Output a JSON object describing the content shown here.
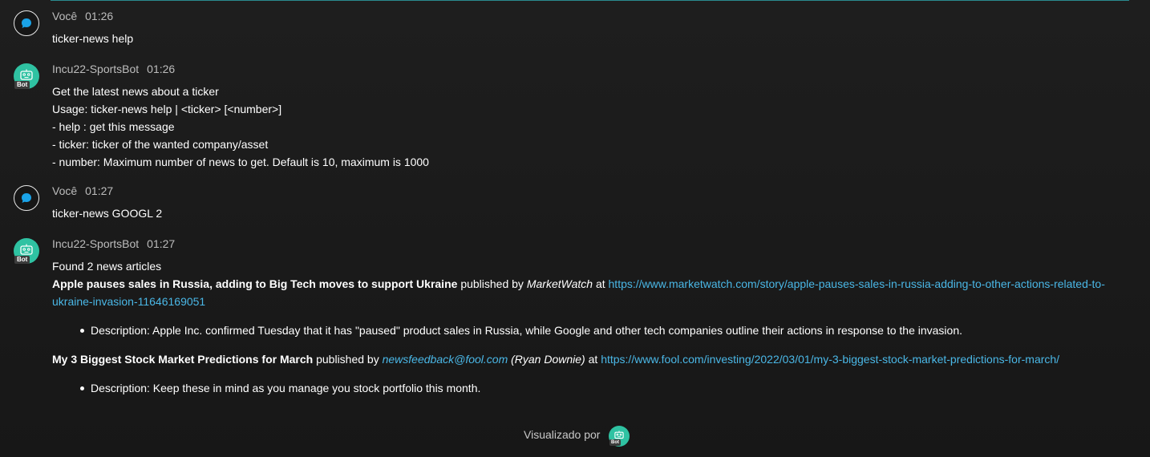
{
  "messages": [
    {
      "author": "Você",
      "time": "01:26",
      "lines": [
        "ticker-news help"
      ]
    },
    {
      "author": "Incu22-SportsBot",
      "badge": "Bot",
      "time": "01:26",
      "lines": [
        "Get the latest news about a ticker",
        "Usage: ticker-news help | <ticker> [<number>]",
        "- help : get this message",
        "- ticker: ticker of the wanted company/asset",
        "- number: Maximum number of news to get. Default is 10, maximum is 1000"
      ]
    },
    {
      "author": "Você",
      "time": "01:27",
      "lines": [
        "ticker-news GOOGL 2"
      ]
    },
    {
      "author": "Incu22-SportsBot",
      "badge": "Bot",
      "time": "01:27",
      "intro": "Found 2 news articles",
      "articles": [
        {
          "title": "Apple pauses sales in Russia, adding to Big Tech moves to support Ukraine",
          "published_by_label": "published by",
          "publisher": "MarketWatch",
          "at_label": "at",
          "url": "https://www.marketwatch.com/story/apple-pauses-sales-in-russia-adding-to-other-actions-related-to-ukraine-invasion-11646169051",
          "description": "Description: Apple Inc. confirmed Tuesday that it has \"paused\" product sales in Russia, while Google and other tech companies outline their actions in response to the invasion."
        },
        {
          "title": "My 3 Biggest Stock Market Predictions for March",
          "published_by_label": "published by",
          "publisher": "newsfeedback@fool.com",
          "author_note": "(Ryan Downie)",
          "at_label": "at",
          "url": "https://www.fool.com/investing/2022/03/01/my-3-biggest-stock-market-predictions-for-march/",
          "description": "Description: Keep these in mind as you manage you stock portfolio this month."
        }
      ]
    }
  ],
  "seen_by": {
    "label": "Visualizado por",
    "badge": "Bot"
  },
  "colors": {
    "background": "#1c1c1c",
    "bot_avatar": "#2fc2a2",
    "link": "#4ab7e6",
    "user_icon": "#1aa3e8"
  },
  "icons": {
    "user_avatar": "chat-bubble-icon",
    "bot_avatar": "robot-face-icon"
  }
}
